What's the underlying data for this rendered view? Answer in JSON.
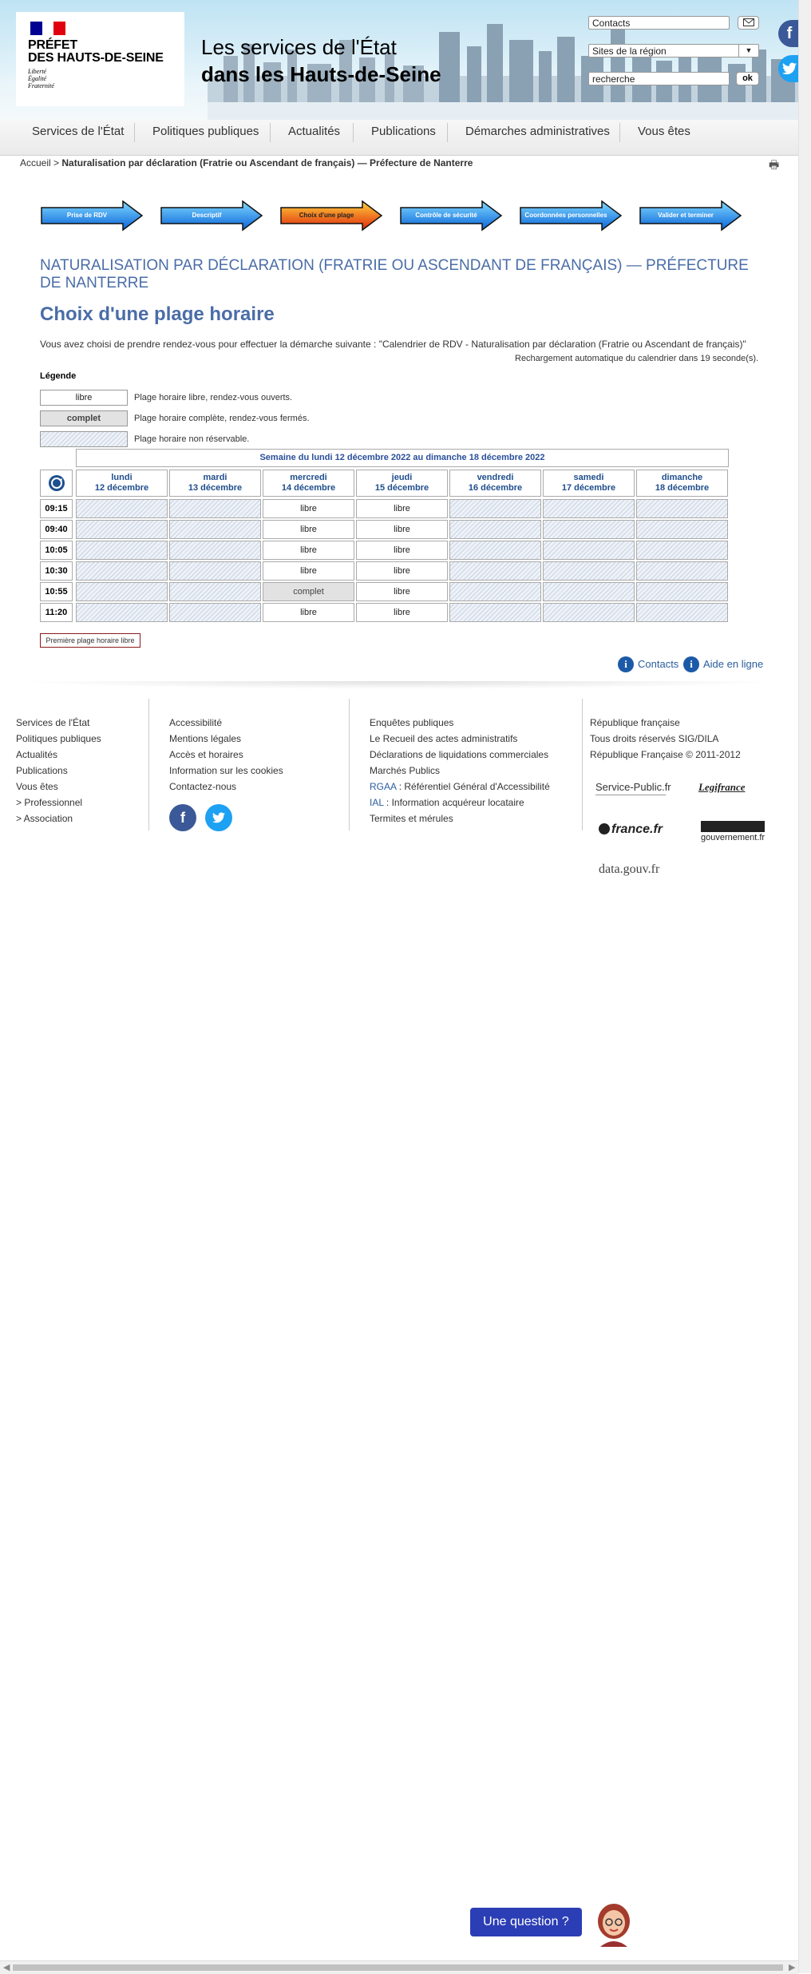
{
  "header": {
    "logo": {
      "line1": "PRÉFET",
      "line2": "DES HAUTS-DE-SEINE",
      "devise": [
        "Liberté",
        "Égalité",
        "Fraternité"
      ]
    },
    "title_line1": "Les services de l'État",
    "title_line2": "dans les Hauts-de-Seine",
    "contacts_field": "Contacts",
    "region_select": "Sites de la région",
    "search_value": "recherche",
    "search_button": "ok",
    "social": {
      "facebook": "f",
      "twitter": "t"
    }
  },
  "nav": {
    "items": [
      "Services de l'État",
      "Politiques publiques",
      "Actualités",
      "Publications",
      "Démarches administratives",
      "Vous êtes"
    ]
  },
  "breadcrumb": {
    "home": "Accueil",
    "sep": ">",
    "current": "Naturalisation par déclaration (Fratrie ou Ascendant de français) — Préfecture de Nanterre"
  },
  "steps": [
    {
      "label": "Prise de RDV",
      "active": false
    },
    {
      "label": "Descriptif",
      "active": false
    },
    {
      "label": "Choix d'une plage",
      "active": true
    },
    {
      "label": "Contrôle de sécurité",
      "active": false
    },
    {
      "label": "Coordonnées personnelles",
      "active": false
    },
    {
      "label": "Valider et terminer",
      "active": false
    }
  ],
  "main": {
    "heading": "Naturalisation par déclaration (Fratrie ou Ascendant de français) — Préfecture de Nanterre",
    "subheading": "Choix d'une plage horaire",
    "intro": "Vous avez choisi de prendre rendez-vous pour effectuer la démarche suivante : \"Calendrier de RDV - Naturalisation par déclaration (Fratrie ou Ascendant de français)\"",
    "reload_text": "Rechargement automatique du calendrier dans 19   seconde(s).",
    "legend_title": "Légende",
    "legend": [
      {
        "box": "libre",
        "text": "Plage horaire libre, rendez-vous ouverts."
      },
      {
        "box": "complet",
        "text": "Plage horaire complète, rendez-vous fermés."
      },
      {
        "box": "",
        "text": "Plage horaire non réservable."
      }
    ],
    "first_free_button": "Première plage horaire libre",
    "contacts_link": "Contacts",
    "help_link": "Aide en ligne"
  },
  "calendar": {
    "week_label": "Semaine du lundi 12 décembre 2022 au dimanche 18 décembre 2022",
    "days": [
      {
        "name": "lundi",
        "date": "12 décembre"
      },
      {
        "name": "mardi",
        "date": "13 décembre"
      },
      {
        "name": "mercredi",
        "date": "14 décembre"
      },
      {
        "name": "jeudi",
        "date": "15 décembre"
      },
      {
        "name": "vendredi",
        "date": "16 décembre"
      },
      {
        "name": "samedi",
        "date": "17 décembre"
      },
      {
        "name": "dimanche",
        "date": "18 décembre"
      }
    ],
    "rows": [
      {
        "time": "09:15",
        "slots": [
          "",
          "",
          "libre",
          "libre",
          "",
          "",
          ""
        ]
      },
      {
        "time": "09:40",
        "slots": [
          "",
          "",
          "libre",
          "libre",
          "",
          "",
          ""
        ]
      },
      {
        "time": "10:05",
        "slots": [
          "",
          "",
          "libre",
          "libre",
          "",
          "",
          ""
        ]
      },
      {
        "time": "10:30",
        "slots": [
          "",
          "",
          "libre",
          "libre",
          "",
          "",
          ""
        ]
      },
      {
        "time": "10:55",
        "slots": [
          "",
          "",
          "complet",
          "libre",
          "",
          "",
          ""
        ]
      },
      {
        "time": "11:20",
        "slots": [
          "",
          "",
          "libre",
          "libre",
          "",
          "",
          ""
        ]
      }
    ]
  },
  "footer": {
    "col1": [
      "Services de l'État",
      "Politiques publiques",
      "Actualités",
      "Publications",
      "Vous êtes",
      "> Professionnel",
      "> Association"
    ],
    "col2": [
      "Accessibilité",
      "Mentions légales",
      "Accès et horaires",
      "Information sur les cookies",
      "Contactez-nous"
    ],
    "col3": [
      {
        "prefix": "",
        "text": "Enquêtes publiques"
      },
      {
        "prefix": "",
        "text": "Le Recueil des actes administratifs"
      },
      {
        "prefix": "",
        "text": "Déclarations de liquidations commerciales"
      },
      {
        "prefix": "",
        "text": "Marchés Publics"
      },
      {
        "prefix": "RGAA",
        "text": " : Référentiel Général d'Accessibilité"
      },
      {
        "prefix": "IAL",
        "text": " : Information acquéreur locataire"
      },
      {
        "prefix": "",
        "text": "Termites et mérules"
      }
    ],
    "col4": [
      "République française",
      "Tous droits réservés SIG/DILA",
      "République Française © 2011-2012"
    ],
    "partners": [
      "Service-Public.fr",
      "Legifrance",
      "france.fr",
      "gouvernement.fr",
      "data.gouv.fr"
    ]
  },
  "chat": {
    "button": "Une question ?"
  }
}
